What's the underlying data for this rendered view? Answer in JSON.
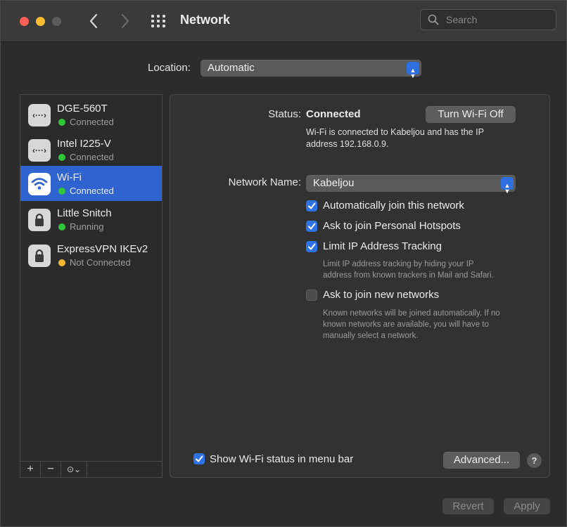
{
  "window": {
    "title": "Network"
  },
  "search": {
    "placeholder": "Search"
  },
  "location": {
    "label": "Location:",
    "value": "Automatic"
  },
  "sidebar": {
    "items": [
      {
        "name": "DGE-560T",
        "status": "Connected",
        "status_color": "#30c83a",
        "icon": "ethernet-icon"
      },
      {
        "name": "Intel I225-V",
        "status": "Connected",
        "status_color": "#30c83a",
        "icon": "ethernet-icon"
      },
      {
        "name": "Wi-Fi",
        "status": "Connected",
        "status_color": "#30c83a",
        "icon": "wifi-icon",
        "selected": true
      },
      {
        "name": "Little Snitch",
        "status": "Running",
        "status_color": "#30c83a",
        "icon": "lock-icon"
      },
      {
        "name": "ExpressVPN IKEv2",
        "status": "Not Connected",
        "status_color": "#f5b82e",
        "icon": "lock-icon"
      }
    ],
    "tools": {
      "add": "+",
      "remove": "−",
      "more": "⊙⌄"
    }
  },
  "detail": {
    "status_label": "Status:",
    "status_value": "Connected",
    "turn_off_button": "Turn Wi-Fi Off",
    "status_description_line1": "Wi-Fi is connected to Kabeljou and has the IP",
    "status_description_line2": "address 192.168.0.9.",
    "network_name_label": "Network Name:",
    "network_name_value": "Kabeljou",
    "auto_join": {
      "label": "Automatically join this network",
      "checked": true
    },
    "ask_hotspots": {
      "label": "Ask to join Personal Hotspots",
      "checked": true
    },
    "limit_ip": {
      "label": "Limit IP Address Tracking",
      "checked": true,
      "hint_line1": "Limit IP address tracking by hiding your IP",
      "hint_line2": "address from known trackers in Mail and Safari."
    },
    "ask_new": {
      "label": "Ask to join new networks",
      "checked": false,
      "hint_line1": "Known networks will be joined automatically. If no",
      "hint_line2": "known networks are available, you will have to",
      "hint_line3": "manually select a network."
    },
    "show_status": {
      "label": "Show Wi-Fi status in menu bar",
      "checked": true
    },
    "advanced_button": "Advanced...",
    "help_button": "?"
  },
  "footer": {
    "revert_button": "Revert",
    "apply_button": "Apply"
  },
  "colors": {
    "accent": "#2f73e8",
    "selection": "#2f63d0"
  }
}
